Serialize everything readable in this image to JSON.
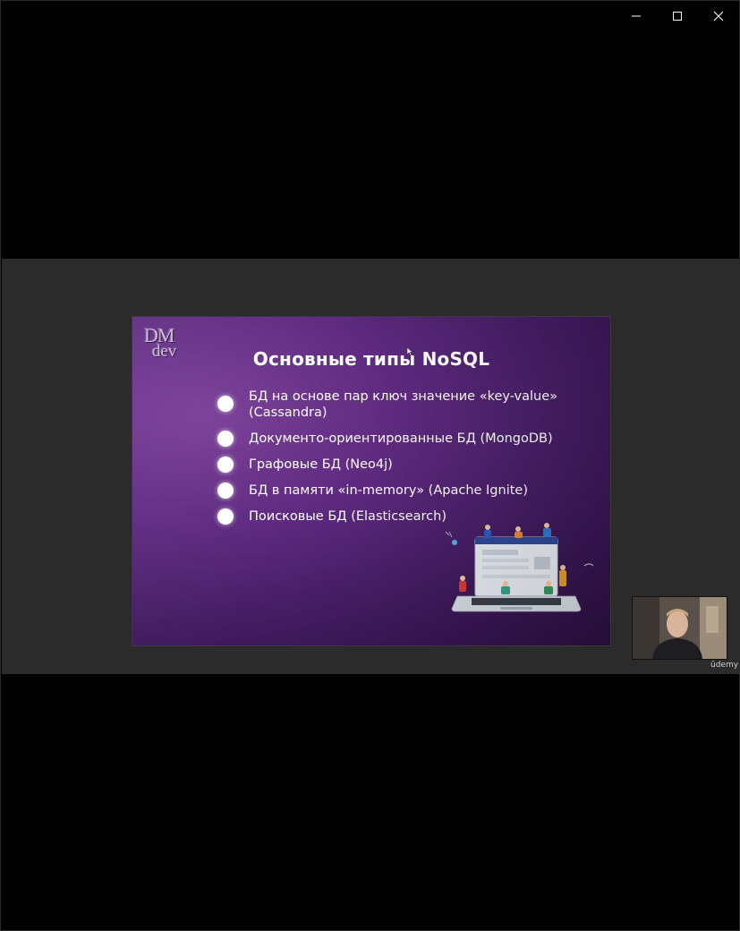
{
  "window": {
    "controls": [
      {
        "name": "minimize-button",
        "icon": "minimize-icon"
      },
      {
        "name": "maximize-button",
        "icon": "maximize-icon"
      },
      {
        "name": "close-button",
        "icon": "close-icon"
      }
    ]
  },
  "slide": {
    "logo_line1": "DM",
    "logo_line2": "dev",
    "title": "Основные типы NoSQL",
    "bullets": [
      "БД на основе пар ключ  значение «key-value» (Cassandra)",
      "Документо-ориентированные БД (MongoDB)",
      "Графовые БД (Neo4j)",
      "БД в памяти «in-memory» (Apache Ignite)",
      "Поисковые БД (Elasticsearch)"
    ],
    "illustration": "people-with-laptop-illustration"
  },
  "webcam": {
    "label": "presenter-webcam"
  },
  "watermark": "ūdemy",
  "colors": {
    "slide_purple": "#5e2a80",
    "background": "#2b2b2b",
    "frame": "#000000"
  }
}
